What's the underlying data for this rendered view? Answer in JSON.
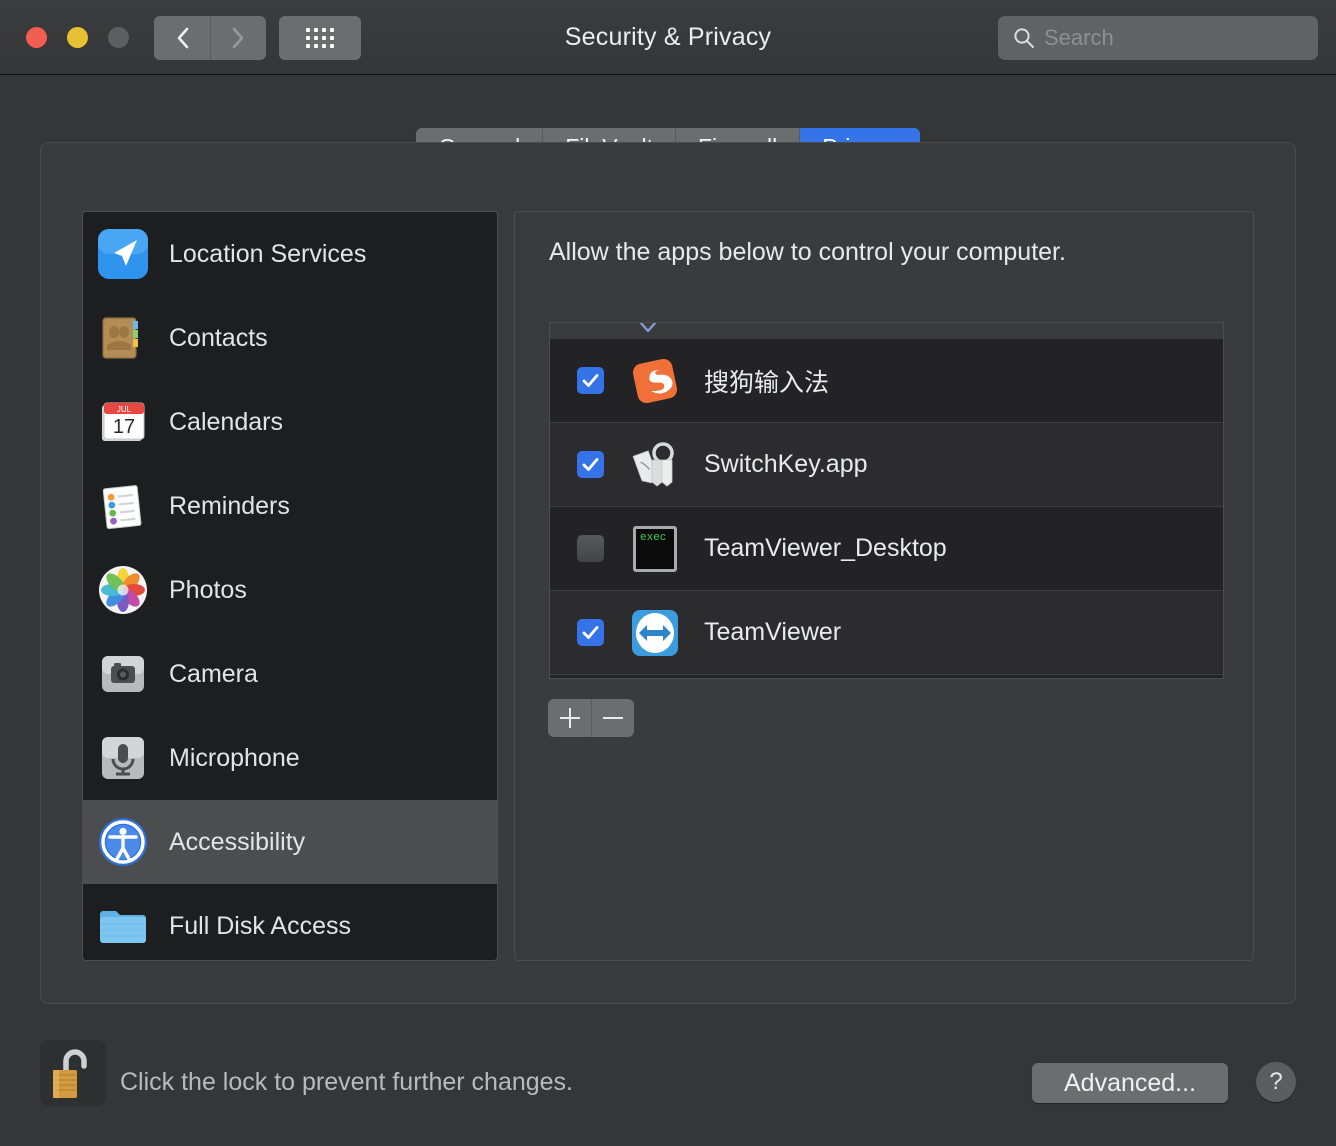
{
  "window": {
    "title": "Security & Privacy",
    "traffic_lights": [
      {
        "name": "close",
        "color": "#f15d51"
      },
      {
        "name": "minimize",
        "color": "#e6c134"
      },
      {
        "name": "zoom",
        "color": "#5d5e60"
      }
    ],
    "nav": {
      "back_icon": "chevron-left-icon",
      "forward_icon": "chevron-right-icon",
      "grid_icon": "show-all-grid-icon"
    }
  },
  "search": {
    "value": "",
    "placeholder": "Search",
    "icon": "search-icon"
  },
  "tabs": [
    {
      "label": "General",
      "active": false
    },
    {
      "label": "FileVault",
      "active": false
    },
    {
      "label": "Firewall",
      "active": false
    },
    {
      "label": "Privacy",
      "active": true
    }
  ],
  "accent_color": "#3574e8",
  "sidebar": {
    "items": [
      {
        "label": "Location Services",
        "icon": "location-arrow-icon",
        "selected": false
      },
      {
        "label": "Contacts",
        "icon": "address-book-icon",
        "selected": false
      },
      {
        "label": "Calendars",
        "icon": "calendar-icon",
        "selected": false,
        "calendar_month": "JUL",
        "calendar_day": "17"
      },
      {
        "label": "Reminders",
        "icon": "reminders-list-icon",
        "selected": false
      },
      {
        "label": "Photos",
        "icon": "photos-flower-icon",
        "selected": false
      },
      {
        "label": "Camera",
        "icon": "camera-icon",
        "selected": false
      },
      {
        "label": "Microphone",
        "icon": "microphone-icon",
        "selected": false
      },
      {
        "label": "Accessibility",
        "icon": "accessibility-person-icon",
        "selected": true
      },
      {
        "label": "Full Disk Access",
        "icon": "blue-folder-icon",
        "selected": false
      }
    ]
  },
  "main": {
    "description": "Allow the apps below to control your computer.",
    "sort_indicator_icon": "chevron-down-icon",
    "apps": [
      {
        "name": "搜狗输入法",
        "checked": true,
        "icon": "sogou-input-icon"
      },
      {
        "name": "SwitchKey.app",
        "checked": true,
        "icon": "key-tags-icon"
      },
      {
        "name": "TeamViewer_Desktop",
        "checked": false,
        "icon": "terminal-exec-icon",
        "icon_text": "exec"
      },
      {
        "name": "TeamViewer",
        "checked": true,
        "icon": "teamviewer-arrow-icon"
      }
    ],
    "add_button_label": "+",
    "remove_button_label": "−"
  },
  "footer": {
    "lock_icon": "open-padlock-icon",
    "lock_message": "Click the lock to prevent further changes.",
    "advanced_label": "Advanced...",
    "help_label": "?"
  }
}
